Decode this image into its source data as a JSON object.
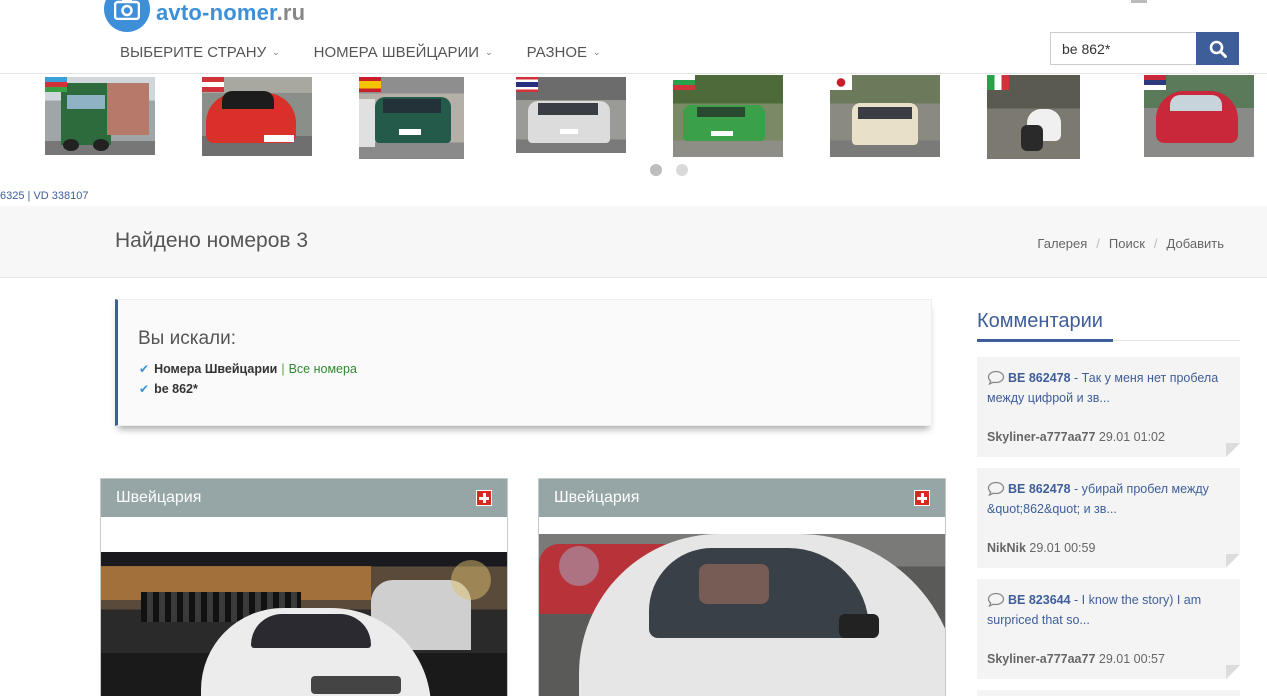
{
  "header": {
    "logo_main": "avto-",
    "logo_accent": "nomer",
    "logo_domain": ".ru",
    "nav": [
      {
        "label": "ВЫБЕРИТЕ СТРАНУ"
      },
      {
        "label": "НОМЕРА ШВЕЙЦАРИИ"
      },
      {
        "label": "РАЗНОЕ"
      }
    ],
    "search_value": "be 862*"
  },
  "thumbnails": [
    {
      "country": "Azerbaijan",
      "flag": "azerbaijan-flag-icon",
      "color": "#2e6b3c"
    },
    {
      "country": "Austria",
      "flag": "austria-flag-icon",
      "color": "#d9302a"
    },
    {
      "country": "Spain",
      "flag": "spain-flag-icon",
      "color": "#245a4a"
    },
    {
      "country": "Thailand",
      "flag": "thailand-flag-icon",
      "color": "#dcdcdc"
    },
    {
      "country": "Bulgaria",
      "flag": "bulgaria-flag-icon",
      "color": "#3aa04a"
    },
    {
      "country": "Japan",
      "flag": "japan-flag-icon",
      "color": "#e8e0c8"
    },
    {
      "country": "Italy",
      "flag": "italy-flag-icon",
      "color": "#2a2a2a"
    },
    {
      "country": "Serbia",
      "flag": "serbia-flag-icon",
      "color": "#c8283a"
    }
  ],
  "ticker": "6325 | VD 338107",
  "page": {
    "title": "Найдено номеров 3",
    "breadcrumb": [
      "Галерея",
      "Поиск",
      "Добавить"
    ]
  },
  "summary": {
    "title": "Вы искали:",
    "country": "Номера Швейцарии",
    "all_link": "Все номера",
    "query": "be 862*"
  },
  "results": [
    {
      "title": "Швейцария"
    },
    {
      "title": "Швейцария"
    }
  ],
  "sidebar": {
    "title": "Комментарии",
    "comments": [
      {
        "plate": "BE 862478",
        "text": " - Так у меня нет пробела между цифрой и зв...",
        "user": "Skyliner-a777aa77",
        "time": "29.01 01:02"
      },
      {
        "plate": "BE 862478",
        "text": " - убирай пробел между &quot;862&quot; и зв...",
        "user": "NikNik",
        "time": "29.01 00:59"
      },
      {
        "plate": "BE 823644",
        "text": " - I know the story) I am surpriced that so...",
        "user": "Skyliner-a777aa77",
        "time": "29.01 00:57"
      }
    ]
  },
  "colors": {
    "brand": "#3d8fd8",
    "nav_dark": "#3e5e9a",
    "card_head": "#96a5a5",
    "link_green": "#2f8a2f"
  }
}
